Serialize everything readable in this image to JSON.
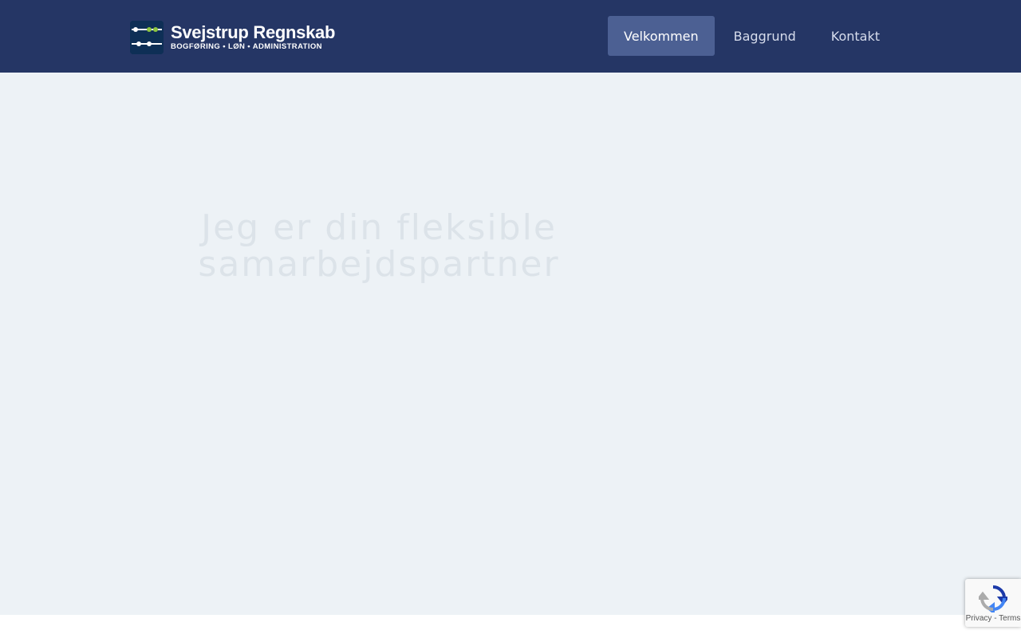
{
  "brand": {
    "title": "Svejstrup Regnskab",
    "tagline": "BOGFØRING • LØN • ADMINISTRATION",
    "icon": "abacus-logo-icon"
  },
  "nav": {
    "items": [
      {
        "label": "Velkommen",
        "active": true
      },
      {
        "label": "Baggrund",
        "active": false
      },
      {
        "label": "Kontakt",
        "active": false
      }
    ]
  },
  "hero": {
    "heading_line1": "Jeg er din fleksible",
    "heading_line2": "samarbejdspartner"
  },
  "recaptcha": {
    "privacy": "Privacy",
    "separator": " - ",
    "terms": "Terms",
    "icon": "recaptcha-icon"
  },
  "colors": {
    "header_bg": "#253665",
    "nav_active_bg": "#4c6093",
    "hero_bg": "#edf2f6",
    "logo_accent": "#8dc63f"
  }
}
